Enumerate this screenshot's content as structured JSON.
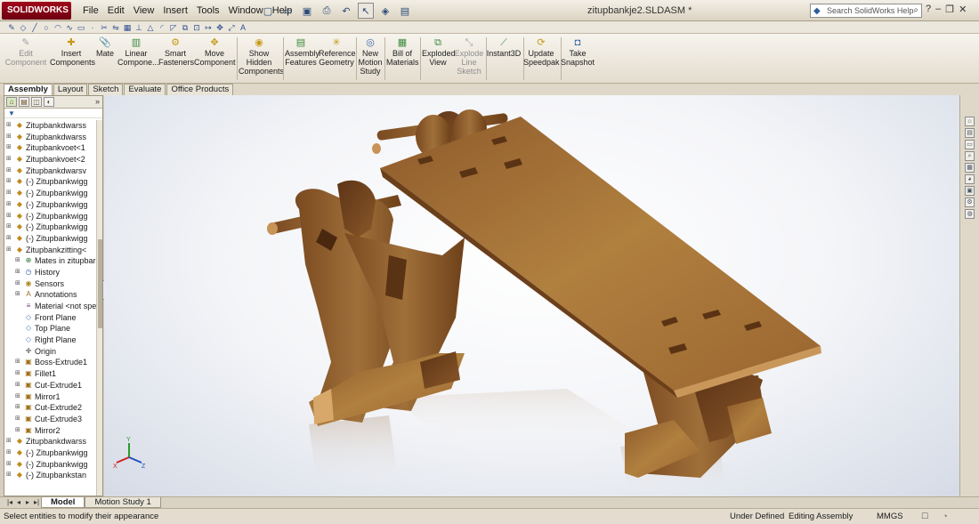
{
  "app": {
    "logo": "SOLIDWORKS",
    "document_title": "zitupbankje2.SLDASM *"
  },
  "menu": [
    "File",
    "Edit",
    "View",
    "Insert",
    "Tools",
    "Window",
    "Help"
  ],
  "help_search": {
    "placeholder": "Search SolidWorks Help"
  },
  "ribbon": {
    "edit_component": "Edit\nComponent",
    "insert_components": "Insert\nComponents",
    "mate": "Mate",
    "linear_component": "Linear\nCompone...",
    "smart_fasteners": "Smart\nFasteners",
    "move_component": "Move\nComponent",
    "show_hidden": "Show\nHidden\nComponents",
    "assembly_features": "Assembly\nFeatures",
    "reference_geometry": "Reference\nGeometry",
    "new_motion_study": "New\nMotion\nStudy",
    "bill_of_materials": "Bill of\nMaterials",
    "exploded_view": "Exploded\nView",
    "explode_line_sketch": "Explode\nLine\nSketch",
    "instant3d": "Instant3D",
    "update_speedpak": "Update\nSpeedpak",
    "take_snapshot": "Take\nSnapshot"
  },
  "tabs": [
    "Assembly",
    "Layout",
    "Sketch",
    "Evaluate",
    "Office Products"
  ],
  "tree": {
    "items": [
      {
        "label": "Zitupbankdwarss",
        "indent": 0,
        "icon": "part"
      },
      {
        "label": "Zitupbankdwarss",
        "indent": 0,
        "icon": "part"
      },
      {
        "label": "Zitupbankvoet<1",
        "indent": 0,
        "icon": "part"
      },
      {
        "label": "Zitupbankvoet<2",
        "indent": 0,
        "icon": "part"
      },
      {
        "label": "Zitupbankdwarsv",
        "indent": 0,
        "icon": "part"
      },
      {
        "label": "(-) Zitupbankwigg",
        "indent": 0,
        "icon": "part"
      },
      {
        "label": "(-) Zitupbankwigg",
        "indent": 0,
        "icon": "part"
      },
      {
        "label": "(-) Zitupbankwigg",
        "indent": 0,
        "icon": "part"
      },
      {
        "label": "(-) Zitupbankwigg",
        "indent": 0,
        "icon": "part"
      },
      {
        "label": "(-) Zitupbankwigg",
        "indent": 0,
        "icon": "part"
      },
      {
        "label": "(-) Zitupbankwigg",
        "indent": 0,
        "icon": "part"
      },
      {
        "label": "Zitupbankzitting<",
        "indent": 0,
        "icon": "part"
      },
      {
        "label": "Mates in zitupbar",
        "indent": 1,
        "icon": "mates"
      },
      {
        "label": "History",
        "indent": 1,
        "icon": "history"
      },
      {
        "label": "Sensors",
        "indent": 1,
        "icon": "sensor"
      },
      {
        "label": "Annotations",
        "indent": 1,
        "icon": "annotation"
      },
      {
        "label": "Material <not spe",
        "indent": 1,
        "icon": "material"
      },
      {
        "label": "Front Plane",
        "indent": 1,
        "icon": "plane"
      },
      {
        "label": "Top Plane",
        "indent": 1,
        "icon": "plane"
      },
      {
        "label": "Right Plane",
        "indent": 1,
        "icon": "plane"
      },
      {
        "label": "Origin",
        "indent": 1,
        "icon": "origin"
      },
      {
        "label": "Boss-Extrude1",
        "indent": 1,
        "icon": "feature"
      },
      {
        "label": "Fillet1",
        "indent": 1,
        "icon": "feature"
      },
      {
        "label": "Cut-Extrude1",
        "indent": 1,
        "icon": "feature"
      },
      {
        "label": "Mirror1",
        "indent": 1,
        "icon": "feature"
      },
      {
        "label": "Cut-Extrude2",
        "indent": 1,
        "icon": "feature"
      },
      {
        "label": "Cut-Extrude3",
        "indent": 1,
        "icon": "feature"
      },
      {
        "label": "Mirror2",
        "indent": 1,
        "icon": "feature"
      },
      {
        "label": "Zitupbankdwarss",
        "indent": 0,
        "icon": "part"
      },
      {
        "label": "(-) Zitupbankwigg",
        "indent": 0,
        "icon": "part"
      },
      {
        "label": "(-) Zitupbankwigg",
        "indent": 0,
        "icon": "part"
      },
      {
        "label": "(-) Zitupbankstan",
        "indent": 0,
        "icon": "part"
      }
    ]
  },
  "bottom_tabs": [
    "Model",
    "Motion Study 1"
  ],
  "status": {
    "message": "Select entities to modify their appearance",
    "definition": "Under Defined",
    "mode": "Editing Assembly",
    "units": "MMGS"
  },
  "triad": {
    "x": "X",
    "y": "Y",
    "z": "Z"
  },
  "colors": {
    "wood_light": "#b07a3a",
    "wood_dark": "#6b3f1a",
    "viewport_bg": "#f4f5f8"
  }
}
